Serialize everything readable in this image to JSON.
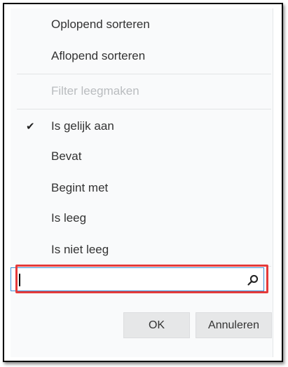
{
  "menu": {
    "sort_items": [
      {
        "label": "Oplopend sorteren"
      },
      {
        "label": "Aflopend sorteren"
      }
    ],
    "clear_filter": {
      "label": "Filter leegmaken",
      "enabled": false
    },
    "filter_options": [
      {
        "label": "Is gelijk aan",
        "checked": true
      },
      {
        "label": "Bevat",
        "checked": false
      },
      {
        "label": "Begint met",
        "checked": false
      },
      {
        "label": "Is leeg",
        "checked": false
      },
      {
        "label": "Is niet leeg",
        "checked": false
      }
    ],
    "check_glyph": "✔"
  },
  "search": {
    "value": "",
    "icon": "search-icon"
  },
  "buttons": {
    "ok_label": "OK",
    "cancel_label": "Annuleren"
  },
  "colors": {
    "highlight": "#e53a3a",
    "focus_border": "#3b8fd4",
    "disabled_text": "#b9bcbf"
  }
}
